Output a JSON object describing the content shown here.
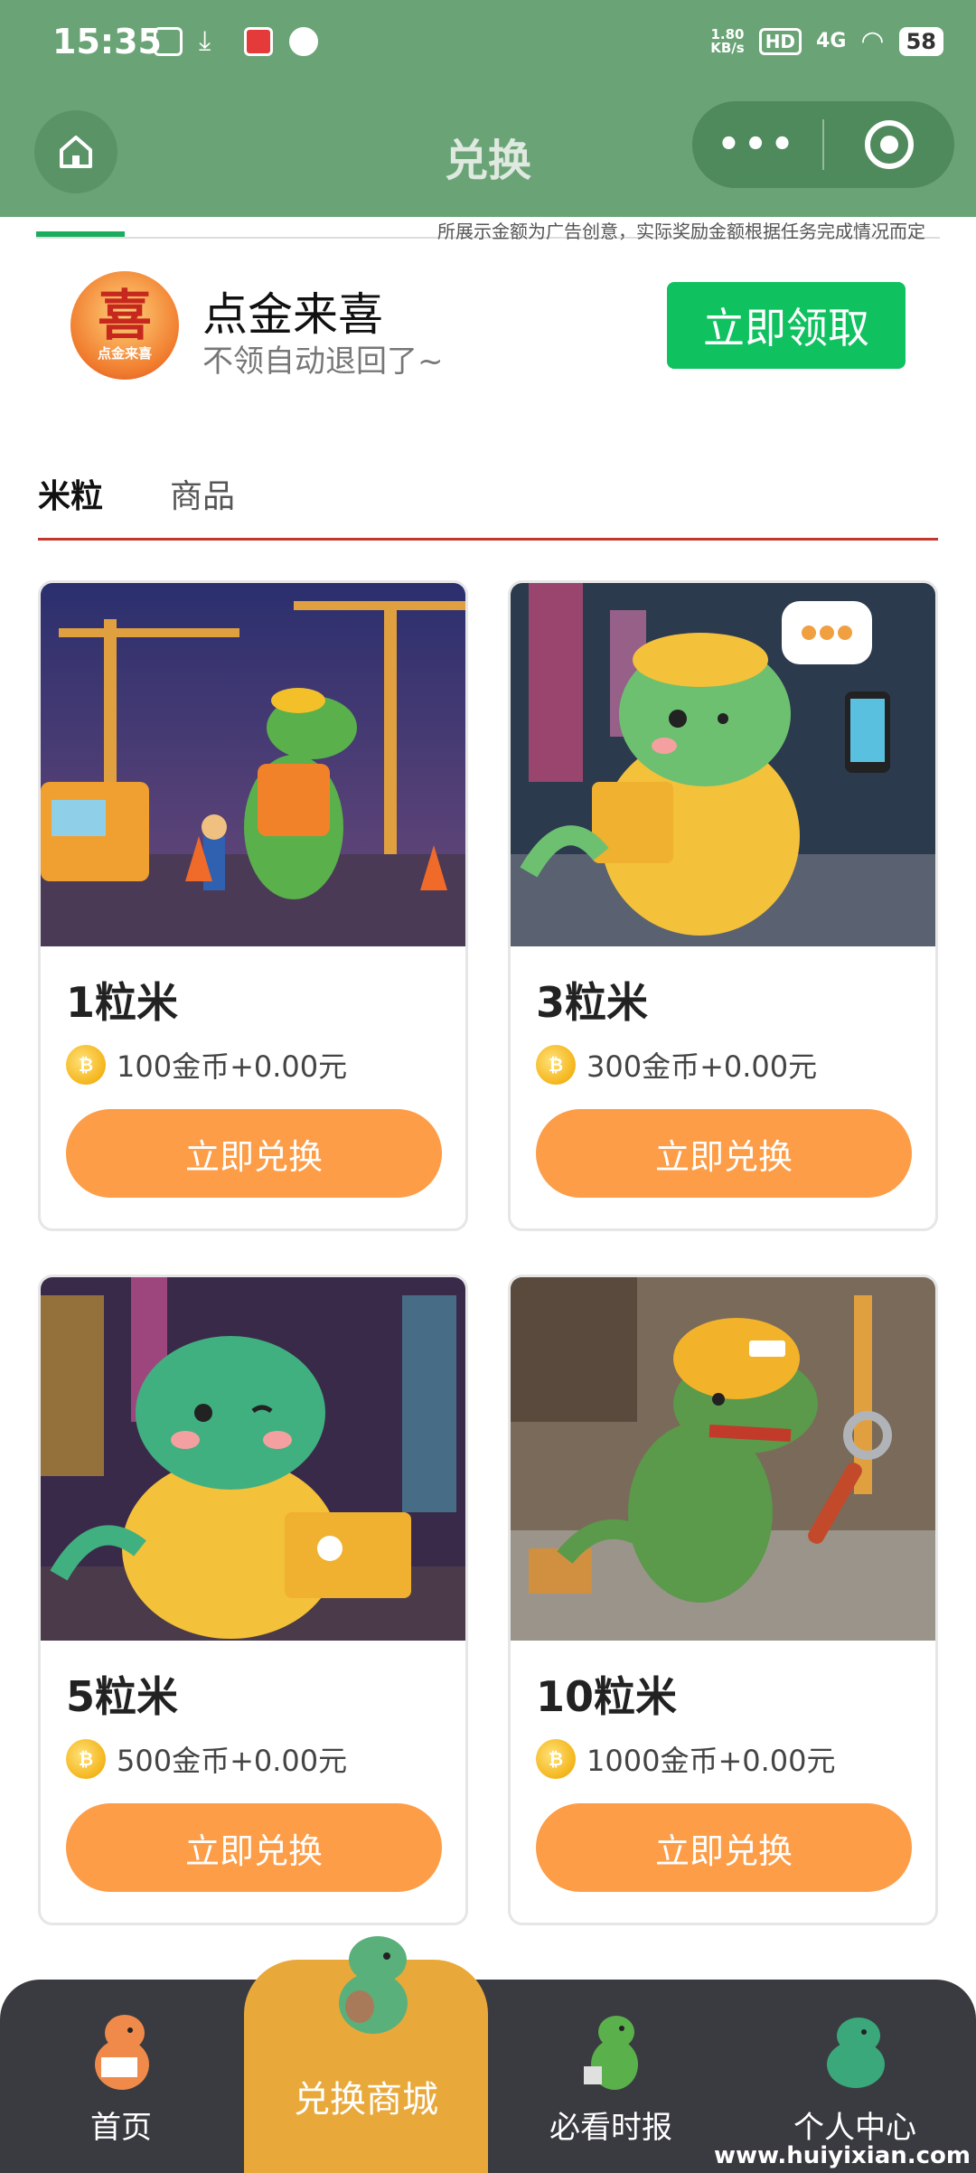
{
  "status_bar": {
    "time": "15:35",
    "net_speed": "1.80",
    "net_unit": "KB/s",
    "hd": "HD",
    "signal": "4G",
    "battery": "58"
  },
  "header": {
    "title": "兑换",
    "more_icon": "more-dots-icon",
    "close_icon": "target-close-icon"
  },
  "ad": {
    "note": "所展示金额为广告创意，实际奖励金额根据任务完成情况而定",
    "logo_text": "喜",
    "logo_caption": "点金来喜",
    "title": "点金来喜",
    "subtitle": "不领自动退回了~",
    "button": "立即领取"
  },
  "tabs": [
    {
      "label": "米粒",
      "active": true
    },
    {
      "label": "商品",
      "active": false
    }
  ],
  "products": [
    {
      "name": "1粒米",
      "price": "100金币+0.00元",
      "button": "立即兑换"
    },
    {
      "name": "3粒米",
      "price": "300金币+0.00元",
      "button": "立即兑换"
    },
    {
      "name": "5粒米",
      "price": "500金币+0.00元",
      "button": "立即兑换"
    },
    {
      "name": "10粒米",
      "price": "1000金币+0.00元",
      "button": "立即兑换"
    }
  ],
  "bottom_nav": [
    {
      "label": "首页"
    },
    {
      "label": "兑换商城"
    },
    {
      "label": "必看时报"
    },
    {
      "label": "个人中心"
    }
  ],
  "watermark": "www.huiyixian.com",
  "colors": {
    "header_bg": "#6aa476",
    "ad_button": "#10c160",
    "exchange_button": "#fd9d48",
    "tab_underline": "#c0392b",
    "nav_bg": "#3a3b40",
    "nav_active": "#e9a93a"
  }
}
